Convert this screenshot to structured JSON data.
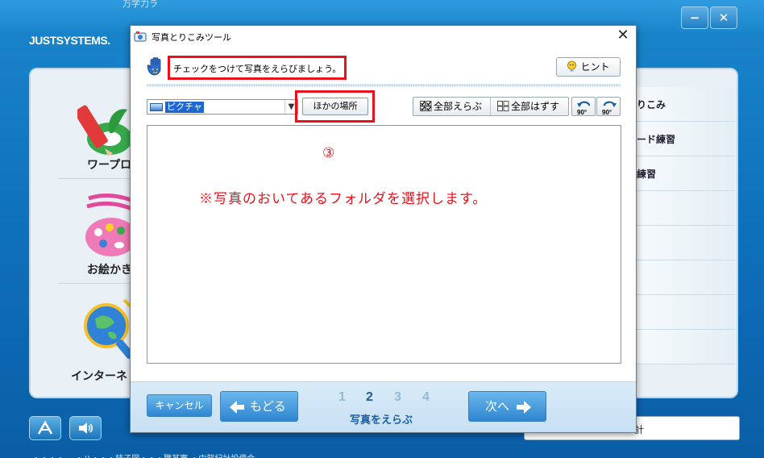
{
  "background": {
    "logo": "JUSTSYSTEMS.",
    "top_text": "万学力ラ",
    "left_items": [
      {
        "label": "ワープロ"
      },
      {
        "label": "お絵かき"
      },
      {
        "label": "インターネ"
      }
    ],
    "right_items": [
      "りこみ",
      "ード練習",
      "練習",
      "",
      "",
      "",
      "",
      ""
    ],
    "search_value": "計",
    "footer_text": "…・・・・… ・ハ・・・柿子図・・・職某寮 ・中賀紀計設借会"
  },
  "dialog": {
    "title": "写真とりこみツール",
    "instruction": "チェックをつけて写真をえらびましょう。",
    "hint_label": "ヒント",
    "folder": {
      "selected": "ピクチャ"
    },
    "other_place_label": "ほかの場所",
    "select_all_label": "全部えらぶ",
    "deselect_all_label": "全部はずす",
    "rotate_left_label": "90°",
    "rotate_right_label": "90°",
    "annotation_number": "③",
    "annotation_text": "※写真のおいてあるフォルダを選択します。",
    "footer": {
      "cancel_label": "キャンセル",
      "back_label": "もどる",
      "next_label": "次へ",
      "steps": [
        "1",
        "2",
        "3",
        "4"
      ],
      "active_step": "2",
      "step_label": "写真をえらぶ"
    }
  },
  "colors": {
    "annotation_red": "#e8101a",
    "accent_blue": "#2d86d0",
    "step_active": "#1b5d9e"
  }
}
